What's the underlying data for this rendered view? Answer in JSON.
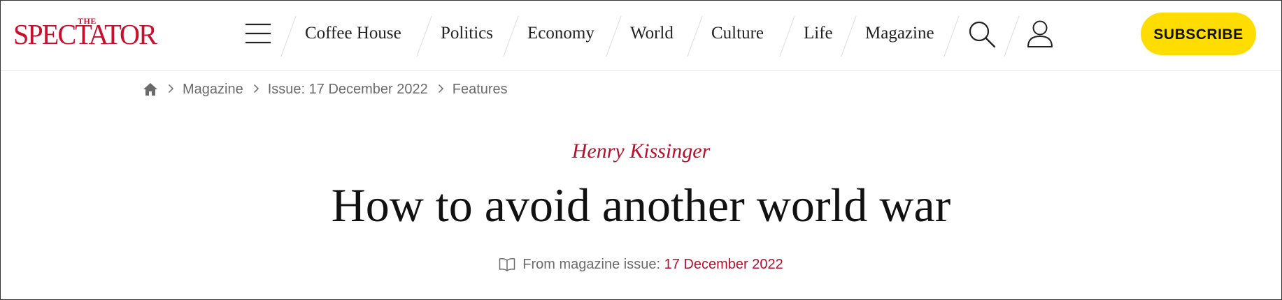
{
  "header": {
    "logo_small": "THE",
    "logo_main": "SPECTATOR",
    "nav": [
      {
        "label": "Coffee House"
      },
      {
        "label": "Politics"
      },
      {
        "label": "Economy"
      },
      {
        "label": "World"
      },
      {
        "label": "Culture"
      },
      {
        "label": "Life"
      },
      {
        "label": "Magazine"
      }
    ],
    "icons": {
      "menu": "hamburger-menu-icon",
      "search": "search-icon",
      "account": "user-icon"
    },
    "subscribe_label": "SUBSCRIBE",
    "colors": {
      "brand_red": "#c8102e",
      "subscribe_yellow": "#ffdd00"
    }
  },
  "breadcrumb": {
    "home_icon": "home-icon",
    "items": [
      "Magazine",
      "Issue: 17 December 2022",
      "Features"
    ]
  },
  "article": {
    "author": "Henry Kissinger",
    "title": "How to avoid another world war",
    "issue_prefix": "From magazine issue:",
    "issue_date": "17 December 2022",
    "issue_icon": "open-book-icon"
  }
}
